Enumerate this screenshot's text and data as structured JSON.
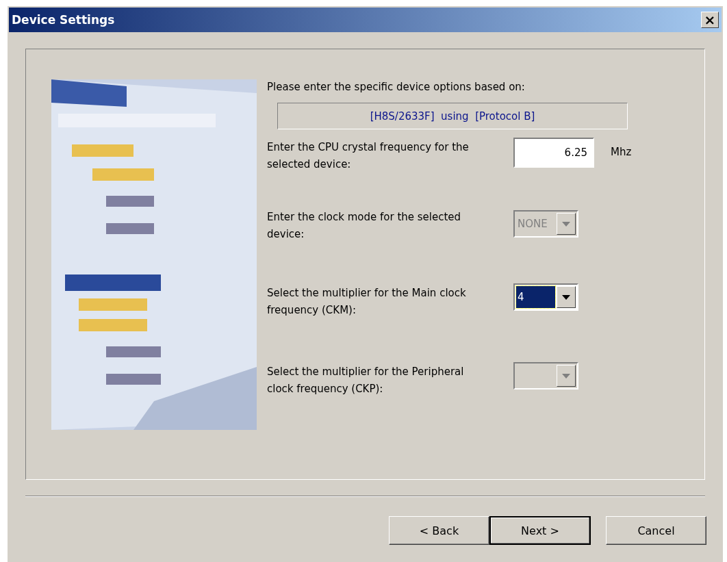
{
  "window": {
    "title": "Device Settings",
    "close_label": "×"
  },
  "intro": "Please enter the specific device options based on:",
  "device_summary": "[H8S/2633F]  using  [Protocol B]",
  "settings": [
    {
      "kind": "text",
      "label": "Enter the CPU crystal frequency for the selected device:",
      "value": "6.25",
      "unit": "Mhz"
    },
    {
      "kind": "combo",
      "label": "Enter the clock mode for the selected device:",
      "value": "NONE",
      "disabled": true,
      "focused": false
    },
    {
      "kind": "combo",
      "label": "Select the multiplier for the Main clock frequency (CKM):",
      "value": "4",
      "disabled": false,
      "focused": true
    },
    {
      "kind": "combo",
      "label": "Select the multiplier for the Peripheral clock frequency (CKP):",
      "disabled": true,
      "focused": false
    }
  ],
  "buttons": [
    {
      "label": "< Back",
      "default": false
    },
    {
      "label": "Next >",
      "default": true
    },
    {
      "label": "Cancel",
      "default": false
    }
  ]
}
